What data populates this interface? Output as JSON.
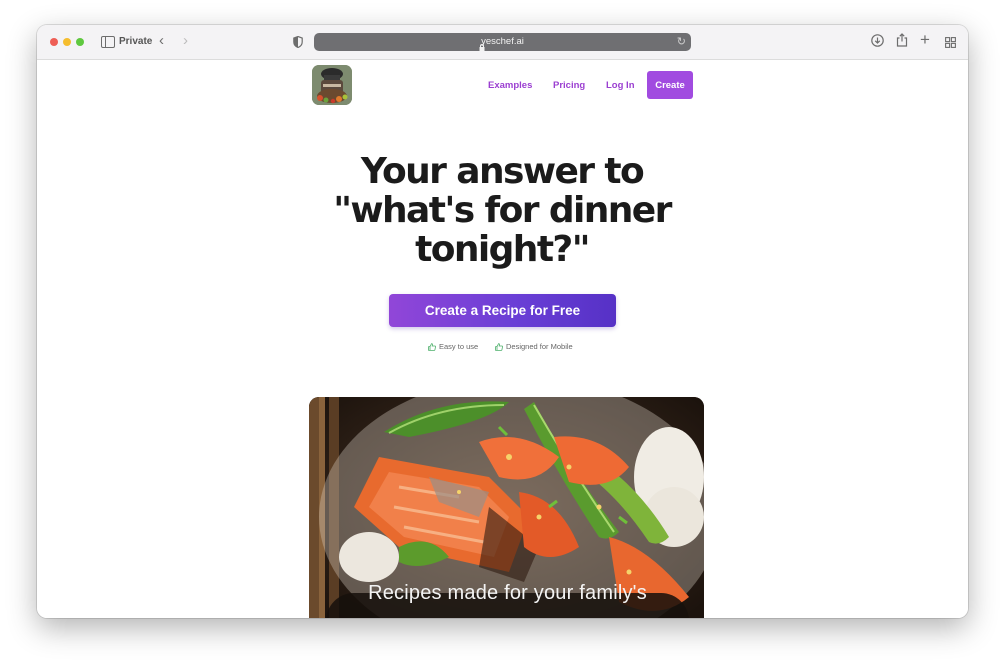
{
  "browser": {
    "private_label": "Private",
    "url": "yeschef.ai"
  },
  "nav": {
    "examples": "Examples",
    "pricing": "Pricing",
    "login": "Log In",
    "create": "Create"
  },
  "hero": {
    "line1": "Your answer to",
    "line2": "\"what's for dinner",
    "line3": "tonight?\""
  },
  "cta": {
    "label": "Create a Recipe for Free"
  },
  "features": [
    {
      "label": "Easy to use",
      "icon": "thumbs-up-icon"
    },
    {
      "label": "Designed for Mobile",
      "icon": "thumbs-up-icon"
    }
  ],
  "image": {
    "caption": "Recipes made for your family's"
  },
  "colors": {
    "accent": "#a14be0",
    "cta_start": "#9146d8",
    "cta_end": "#5631c6",
    "heading": "#1b1b1b"
  }
}
